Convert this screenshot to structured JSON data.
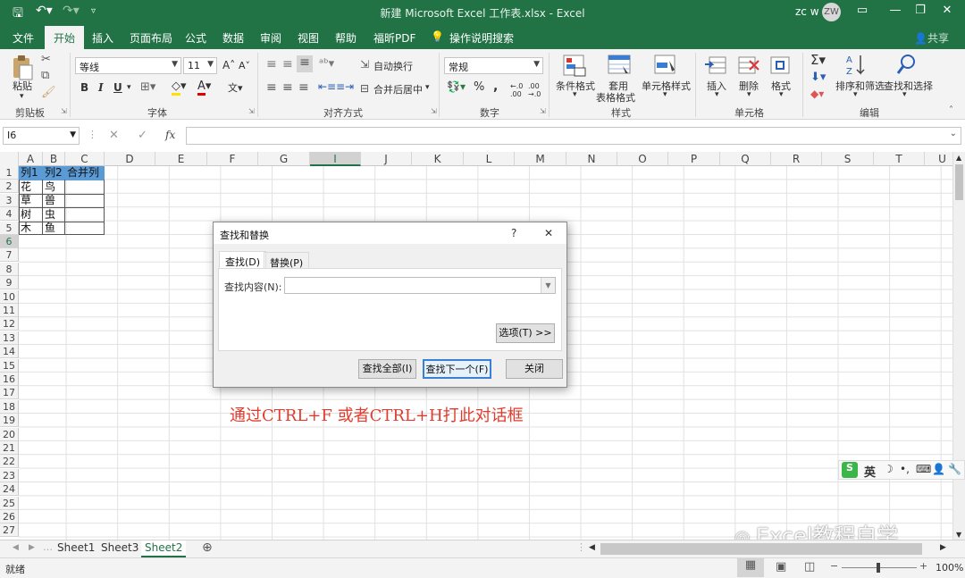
{
  "window": {
    "title": "新建 Microsoft Excel 工作表.xlsx  -  Excel",
    "user_name": "zc w",
    "avatar_initials": "ZW"
  },
  "ribbon": {
    "tabs": [
      "文件",
      "开始",
      "插入",
      "页面布局",
      "公式",
      "数据",
      "审阅",
      "视图",
      "帮助",
      "福昕PDF"
    ],
    "active_tab": "开始",
    "tell_me": "操作说明搜索",
    "share": "共享",
    "clipboard": {
      "paste": "粘贴",
      "group": "剪贴板"
    },
    "font": {
      "name": "等线",
      "size": "11",
      "group": "字体",
      "bold": "B",
      "italic": "I",
      "underline": "U"
    },
    "alignment": {
      "wrap": "自动换行",
      "merge": "合并后居中",
      "group": "对齐方式"
    },
    "number": {
      "format": "常规",
      "group": "数字",
      "percent": "%",
      "comma": ","
    },
    "styles": {
      "conditional": "条件格式",
      "table_format_1": "套用",
      "table_format_2": "表格格式",
      "cell_styles": "单元格样式",
      "group": "样式"
    },
    "cells": {
      "insert": "插入",
      "delete": "删除",
      "format": "格式",
      "group": "单元格"
    },
    "editing": {
      "sort": "排序和筛选",
      "find": "查找和选择",
      "group": "编辑"
    }
  },
  "formula_bar": {
    "name_box": "I6",
    "fx": "fx",
    "value": ""
  },
  "columns": [
    "A",
    "B",
    "C",
    "D",
    "E",
    "F",
    "G",
    "H",
    "I",
    "J",
    "K",
    "L",
    "M",
    "N",
    "O",
    "P",
    "Q",
    "R",
    "S",
    "T",
    "U"
  ],
  "selected_column": "I",
  "rows": [
    "1",
    "2",
    "3",
    "4",
    "5",
    "6",
    "7",
    "8",
    "9",
    "10",
    "11",
    "12",
    "13",
    "14",
    "15",
    "16",
    "17",
    "18",
    "19",
    "20",
    "21",
    "22",
    "23",
    "24",
    "25",
    "26",
    "27"
  ],
  "selected_row": "6",
  "table": {
    "header": [
      "列1",
      "列2",
      "合并列"
    ],
    "rows": [
      [
        "花",
        "鸟",
        ""
      ],
      [
        "草",
        "兽",
        ""
      ],
      [
        "树",
        "虫",
        ""
      ],
      [
        "木",
        "鱼",
        ""
      ]
    ]
  },
  "dialog": {
    "title": "查找和替换",
    "help": "?",
    "close": "✕",
    "tabs": [
      "查找(D)",
      "替换(P)"
    ],
    "find_label": "查找内容(N):",
    "find_value": "",
    "options_button": "选项(T) >>",
    "find_all": "查找全部(I)",
    "find_next": "查找下一个(F)",
    "close_button": "关闭"
  },
  "annotation": "通过CTRL+F  或者CTRL+H打此对话框",
  "sheets": [
    "Sheet1",
    "Sheet3",
    "Sheet2"
  ],
  "active_sheet": "Sheet2",
  "status": {
    "ready": "就绪",
    "zoom": "100%"
  },
  "ime": {
    "label": "英"
  },
  "watermark": "Excel教程自学"
}
